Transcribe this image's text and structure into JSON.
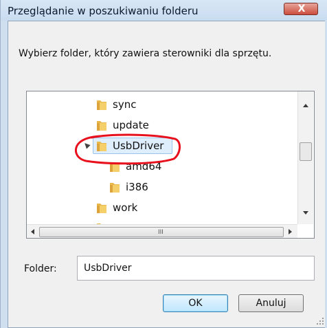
{
  "window": {
    "title": "Przeglądanie w poszukiwaniu folderu",
    "close_label": "X"
  },
  "instruction": "Wybierz folder, który zawiera sterowniki dla sprzętu.",
  "tree": {
    "items": [
      {
        "label": "sync",
        "expanded": false,
        "selected": false,
        "level": 1
      },
      {
        "label": "update",
        "expanded": false,
        "selected": false,
        "level": 1
      },
      {
        "label": "UsbDriver",
        "expanded": true,
        "selected": true,
        "level": 1,
        "highlighted_with": "red-circle"
      },
      {
        "label": "amd64",
        "expanded": false,
        "selected": false,
        "level": 2
      },
      {
        "label": "i386",
        "expanded": false,
        "selected": false,
        "level": 2
      },
      {
        "label": "work",
        "expanded": false,
        "selected": false,
        "level": 1
      }
    ]
  },
  "scrollbar": {
    "h_grip": "III"
  },
  "folder_field": {
    "label": "Folder:",
    "value": "UsbDriver"
  },
  "buttons": {
    "ok": "OK",
    "cancel": "Anuluj"
  },
  "colors": {
    "selection_bg": "#dfeefd",
    "selection_border": "#9ac2ea",
    "annotation": "#e8101c",
    "folder_yellow": "#f2c44f"
  },
  "icons": [
    "folder-icon",
    "close-icon",
    "expanded-arrow-icon",
    "scroll-up-icon",
    "scroll-down-icon",
    "scroll-left-icon",
    "scroll-right-icon",
    "size-grip-icon"
  ]
}
